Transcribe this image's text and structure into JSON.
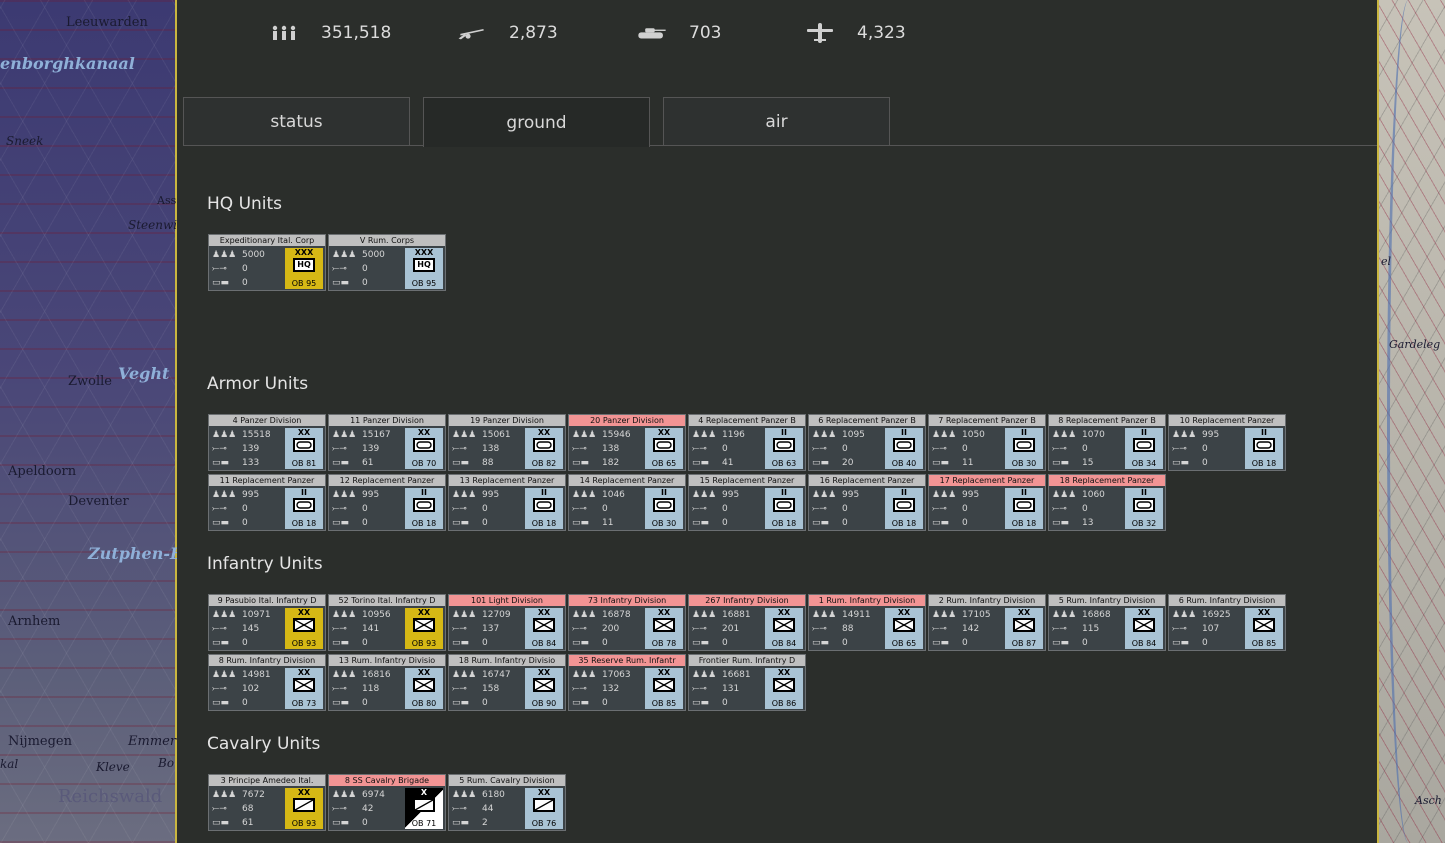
{
  "map_left_labels": [
    "Leeuwarden",
    "enborghkanaal",
    "Sneek",
    "Ass",
    "Steenwi",
    "Zwolle",
    "Veght",
    "Apeldoorn",
    "Deventer",
    "Zutphen-E",
    "Arnhem",
    "Nijmegen",
    "Emmer",
    "Kleve",
    "Bo",
    "kal",
    "Reichswald"
  ],
  "map_right_labels": [
    "el",
    "Gardeleg",
    "Asch"
  ],
  "stats": [
    {
      "icon": "infantry-icon",
      "glyph": "♙♙♙",
      "value": "351,518"
    },
    {
      "icon": "gun-icon",
      "glyph": "⟿",
      "value": "2,873"
    },
    {
      "icon": "tank-icon",
      "glyph": "▬",
      "value": "703"
    },
    {
      "icon": "plane-icon",
      "glyph": "✈",
      "value": "4,323"
    }
  ],
  "tabs": [
    {
      "label": "status",
      "active": false
    },
    {
      "label": "ground",
      "active": true
    },
    {
      "label": "air",
      "active": false
    }
  ],
  "sections": {
    "hq": "HQ Units",
    "armor": "Armor Units",
    "infantry": "Infantry Units",
    "cavalry": "Cavalry Units"
  },
  "hq_units": [
    {
      "name": "Expeditionary Ital. Corp",
      "men": "5000",
      "guns": "0",
      "tanks": "0",
      "echelon": "XXX",
      "ob": "OB 95",
      "color": "yellow",
      "type": "hq",
      "red": false
    },
    {
      "name": "V Rum. Corps",
      "men": "5000",
      "guns": "0",
      "tanks": "0",
      "echelon": "XXX",
      "ob": "OB 95",
      "color": "blue",
      "type": "hq",
      "red": false
    }
  ],
  "armor_units": [
    {
      "name": "4 Panzer Division",
      "men": "15518",
      "guns": "139",
      "tanks": "133",
      "echelon": "XX",
      "ob": "OB 81",
      "color": "blue",
      "type": "armor",
      "red": false
    },
    {
      "name": "11 Panzer Division",
      "men": "15167",
      "guns": "139",
      "tanks": "61",
      "echelon": "XX",
      "ob": "OB 70",
      "color": "blue",
      "type": "armor",
      "red": false
    },
    {
      "name": "19 Panzer Division",
      "men": "15061",
      "guns": "138",
      "tanks": "88",
      "echelon": "XX",
      "ob": "OB 82",
      "color": "blue",
      "type": "armor",
      "red": false
    },
    {
      "name": "20 Panzer Division",
      "men": "15946",
      "guns": "138",
      "tanks": "182",
      "echelon": "XX",
      "ob": "OB 65",
      "color": "blue",
      "type": "armor",
      "red": true
    },
    {
      "name": "4 Replacement Panzer B",
      "men": "1196",
      "guns": "0",
      "tanks": "41",
      "echelon": "II",
      "ob": "OB 63",
      "color": "blue",
      "type": "armor",
      "red": false
    },
    {
      "name": "6 Replacement Panzer B",
      "men": "1095",
      "guns": "0",
      "tanks": "20",
      "echelon": "II",
      "ob": "OB 40",
      "color": "blue",
      "type": "armor",
      "red": false
    },
    {
      "name": "7 Replacement Panzer B",
      "men": "1050",
      "guns": "0",
      "tanks": "11",
      "echelon": "II",
      "ob": "OB 30",
      "color": "blue",
      "type": "armor",
      "red": false
    },
    {
      "name": "8 Replacement Panzer B",
      "men": "1070",
      "guns": "0",
      "tanks": "15",
      "echelon": "II",
      "ob": "OB 34",
      "color": "blue",
      "type": "armor",
      "red": false
    },
    {
      "name": "10 Replacement Panzer",
      "men": "995",
      "guns": "0",
      "tanks": "0",
      "echelon": "II",
      "ob": "OB 18",
      "color": "blue",
      "type": "armor",
      "red": false
    },
    {
      "name": "11 Replacement Panzer",
      "men": "995",
      "guns": "0",
      "tanks": "0",
      "echelon": "II",
      "ob": "OB 18",
      "color": "blue",
      "type": "armor",
      "red": false
    },
    {
      "name": "12 Replacement Panzer",
      "men": "995",
      "guns": "0",
      "tanks": "0",
      "echelon": "II",
      "ob": "OB 18",
      "color": "blue",
      "type": "armor",
      "red": false
    },
    {
      "name": "13 Replacement Panzer",
      "men": "995",
      "guns": "0",
      "tanks": "0",
      "echelon": "II",
      "ob": "OB 18",
      "color": "blue",
      "type": "armor",
      "red": false
    },
    {
      "name": "14 Replacement Panzer",
      "men": "1046",
      "guns": "0",
      "tanks": "11",
      "echelon": "II",
      "ob": "OB 30",
      "color": "blue",
      "type": "armor",
      "red": false
    },
    {
      "name": "15 Replacement Panzer",
      "men": "995",
      "guns": "0",
      "tanks": "0",
      "echelon": "II",
      "ob": "OB 18",
      "color": "blue",
      "type": "armor",
      "red": false
    },
    {
      "name": "16 Replacement Panzer",
      "men": "995",
      "guns": "0",
      "tanks": "0",
      "echelon": "II",
      "ob": "OB 18",
      "color": "blue",
      "type": "armor",
      "red": false
    },
    {
      "name": "17 Replacement Panzer",
      "men": "995",
      "guns": "0",
      "tanks": "0",
      "echelon": "II",
      "ob": "OB 18",
      "color": "blue",
      "type": "armor",
      "red": true
    },
    {
      "name": "18 Replacement Panzer",
      "men": "1060",
      "guns": "0",
      "tanks": "13",
      "echelon": "II",
      "ob": "OB 32",
      "color": "blue",
      "type": "armor",
      "red": true
    }
  ],
  "infantry_units": [
    {
      "name": "9 Pasubio Ital. Infantry D",
      "men": "10971",
      "guns": "145",
      "tanks": "0",
      "echelon": "XX",
      "ob": "OB 93",
      "color": "yellow",
      "type": "infantry",
      "red": false
    },
    {
      "name": "52 Torino Ital. Infantry D",
      "men": "10956",
      "guns": "141",
      "tanks": "0",
      "echelon": "XX",
      "ob": "OB 93",
      "color": "yellow",
      "type": "infantry",
      "red": false
    },
    {
      "name": "101 Light Division",
      "men": "12709",
      "guns": "137",
      "tanks": "0",
      "echelon": "XX",
      "ob": "OB 84",
      "color": "blue",
      "type": "infantry",
      "red": true
    },
    {
      "name": "73 Infantry Division",
      "men": "16878",
      "guns": "200",
      "tanks": "0",
      "echelon": "XX",
      "ob": "OB 78",
      "color": "blue",
      "type": "infantry",
      "red": true
    },
    {
      "name": "267 Infantry Division",
      "men": "16881",
      "guns": "201",
      "tanks": "0",
      "echelon": "XX",
      "ob": "OB 84",
      "color": "blue",
      "type": "infantry",
      "red": true
    },
    {
      "name": "1 Rum. Infantry Division",
      "men": "14911",
      "guns": "88",
      "tanks": "0",
      "echelon": "XX",
      "ob": "OB 65",
      "color": "blue",
      "type": "infantry",
      "red": true
    },
    {
      "name": "2 Rum. Infantry Division",
      "men": "17105",
      "guns": "142",
      "tanks": "0",
      "echelon": "XX",
      "ob": "OB 87",
      "color": "blue",
      "type": "infantry",
      "red": false
    },
    {
      "name": "5 Rum. Infantry Division",
      "men": "16868",
      "guns": "115",
      "tanks": "0",
      "echelon": "XX",
      "ob": "OB 84",
      "color": "blue",
      "type": "infantry",
      "red": false
    },
    {
      "name": "6 Rum. Infantry Division",
      "men": "16925",
      "guns": "107",
      "tanks": "0",
      "echelon": "XX",
      "ob": "OB 85",
      "color": "blue",
      "type": "infantry",
      "red": false
    },
    {
      "name": "8 Rum. Infantry Division",
      "men": "14981",
      "guns": "102",
      "tanks": "0",
      "echelon": "XX",
      "ob": "OB 73",
      "color": "blue",
      "type": "infantry",
      "red": false
    },
    {
      "name": "13 Rum. Infantry Divisio",
      "men": "16816",
      "guns": "118",
      "tanks": "0",
      "echelon": "XX",
      "ob": "OB 80",
      "color": "blue",
      "type": "infantry",
      "red": false
    },
    {
      "name": "18 Rum. Infantry Divisio",
      "men": "16747",
      "guns": "158",
      "tanks": "0",
      "echelon": "XX",
      "ob": "OB 90",
      "color": "blue",
      "type": "infantry",
      "red": false
    },
    {
      "name": "35 Reserve Rum. Infantr",
      "men": "17063",
      "guns": "132",
      "tanks": "0",
      "echelon": "XX",
      "ob": "OB 85",
      "color": "blue",
      "type": "infantry",
      "red": true
    },
    {
      "name": "Frontier Rum. Infantry D",
      "men": "16681",
      "guns": "131",
      "tanks": "0",
      "echelon": "XX",
      "ob": "OB 86",
      "color": "blue",
      "type": "infantry",
      "red": false
    }
  ],
  "cavalry_units": [
    {
      "name": "3 Principe Amedeo Ital.",
      "men": "7672",
      "guns": "68",
      "tanks": "61",
      "echelon": "XX",
      "ob": "OB 93",
      "color": "yellow",
      "type": "cavalry",
      "red": false
    },
    {
      "name": "8 SS Cavalry Brigade",
      "men": "6974",
      "guns": "42",
      "tanks": "0",
      "echelon": "X",
      "ob": "OB 71",
      "color": "black",
      "type": "cavalry",
      "red": true
    },
    {
      "name": "5 Rum. Cavalry Division",
      "men": "6180",
      "guns": "44",
      "tanks": "2",
      "echelon": "XX",
      "ob": "OB 76",
      "color": "blue",
      "type": "cavalry",
      "red": false
    }
  ],
  "colors": {
    "panel": "#2b2e2b",
    "red_header": "#f29494",
    "grey_header": "#bfbfbf",
    "axis_blue": "#a9c3d4",
    "italian_yellow": "#d6b815"
  }
}
